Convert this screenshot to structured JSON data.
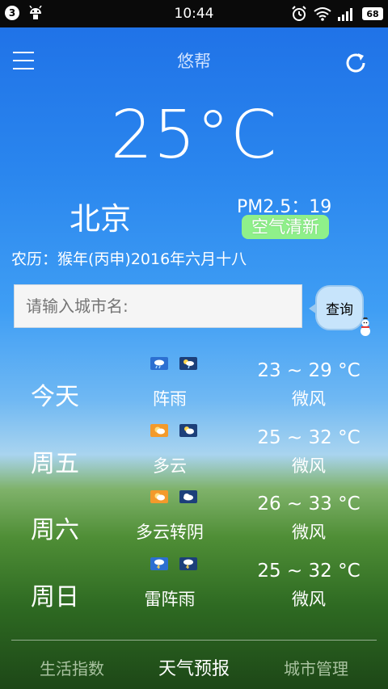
{
  "status_bar": {
    "notification_count": "3",
    "time": "10:44",
    "battery": "68",
    "left_icons": [
      "notification-badge",
      "android-icon"
    ],
    "right_icons": [
      "alarm-icon",
      "wifi-icon",
      "signal-icon",
      "battery-icon"
    ]
  },
  "header": {
    "title": "悠帮",
    "menu_icon": "menu-icon",
    "refresh_icon": "refresh-icon"
  },
  "current": {
    "temperature": "25°C",
    "city": "北京",
    "pm25": "PM2.5：19",
    "air_quality": "空气清新",
    "lunar_date": "农历：猴年(丙申)2016年六月十八"
  },
  "search": {
    "placeholder": "请输入城市名:",
    "button_label": "查询"
  },
  "forecast": [
    {
      "day": "今天",
      "condition": "阵雨",
      "temp": "23 ~ 29 °C",
      "wind": "微风",
      "day_icon": "shower-icon",
      "night_icon": "shower-night-icon"
    },
    {
      "day": "周五",
      "condition": "多云",
      "temp": "25 ~ 32 °C",
      "wind": "微风",
      "day_icon": "cloudy-icon",
      "night_icon": "cloudy-night-icon"
    },
    {
      "day": "周六",
      "condition": "多云转阴",
      "temp": "26 ~ 33 °C",
      "wind": "微风",
      "day_icon": "cloudy-icon",
      "night_icon": "overcast-icon"
    },
    {
      "day": "周日",
      "condition": "雷阵雨",
      "temp": "25 ~ 32 °C",
      "wind": "微风",
      "day_icon": "thunder-shower-icon",
      "night_icon": "thunder-shower-night-icon"
    }
  ],
  "tabs": [
    {
      "label": "生活指数",
      "active": false
    },
    {
      "label": "天气预报",
      "active": true
    },
    {
      "label": "城市管理",
      "active": false
    }
  ],
  "colors": {
    "air_quality_badge": "#8ff08a",
    "sky_top": "#1e6fe6",
    "grass": "#2e6a22"
  }
}
